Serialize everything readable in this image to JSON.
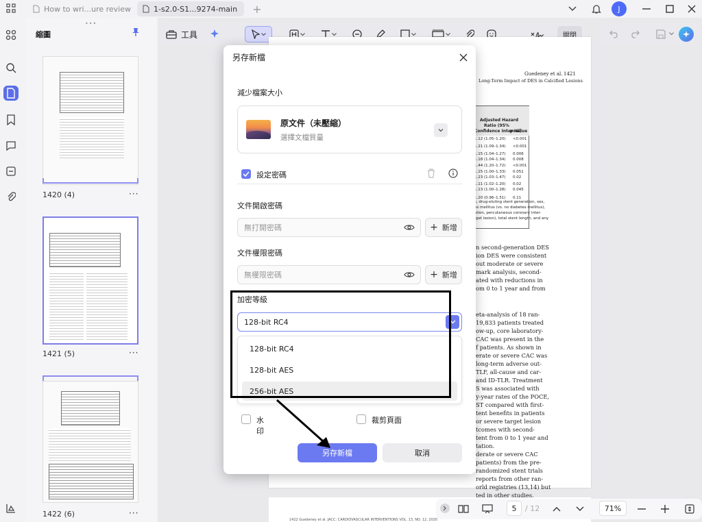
{
  "tabs": [
    {
      "title": "How to wri...ure review"
    },
    {
      "title": "1-s2.0-S1...9274-main"
    }
  ],
  "user": {
    "initial": "J"
  },
  "sidebar": {
    "title": "縮圖",
    "pages": [
      {
        "label": "1420 (4)"
      },
      {
        "label": "1421 (5)"
      },
      {
        "label": "1422 (6)"
      }
    ]
  },
  "toolbar": {
    "tools_label": "工具",
    "close_label": "關閉"
  },
  "document": {
    "header_author": "Guedeney et al.",
    "header_page": "1421",
    "header_title": "Long-Term Impact of DES in Calcified Lesions",
    "table_head_1": "Adjusted Hazard",
    "table_head_2": "Ratio (95%",
    "table_head_3": "Confidence Interval)",
    "table_head_pval": "p Value",
    "table_rows": [
      {
        "ci": "1.12 (1.05–1.20)",
        "p": "<0.001"
      },
      {
        "ci": "1.21 (1.09–1.34)",
        "p": "<0.001"
      },
      {
        "ci": "1.15 (1.04–1.27)",
        "p": "0.006"
      },
      {
        "ci": "1.18 (1.04–1.34)",
        "p": "0.008"
      },
      {
        "ci": "1.44 (1.20–1.72)",
        "p": "<0.001"
      },
      {
        "ci": "1.15 (1.00–1.33)",
        "p": "0.051"
      },
      {
        "ci": "1.23 (1.03–1.47)",
        "p": "0.02"
      },
      {
        "ci": "1.11 (1.02–1.20)",
        "p": "0.02"
      },
      {
        "ci": "1.13 (1.00–1.28)",
        "p": "0.045"
      },
      {
        "ci": "1.20 (0.96–1.51)",
        "p": "0.11"
      }
    ],
    "table_notes": [
      "s, drug-eluting stent generation, sex,",
      "es mellitus (vs. no diabetes mellitus),",
      "ation, percutaneous coronary inter-",
      "rget lesion), total stent length, and any"
    ],
    "body_lines_1": [
      "n second-generation DES",
      "ion DES were consistent",
      "out moderate or severe",
      "mark analysis, second-",
      "ated with reductions in",
      "om 0 to 1 year and from"
    ],
    "body_lines_2": [
      "eta-analysis of 18 ran-",
      "19,833 patients treated",
      "ow-up, core laboratory-",
      "CAC was present in the",
      "f patients. As shown in",
      "erate or severe CAC was",
      "long-term adverse out-",
      "TLF, all-cause and car-",
      "and ID-TLR. Treatment",
      "S was associated with",
      "y-year rates of the POCE,",
      "ST compared with first-",
      "tent benefits in patients",
      "or severe target lesion",
      "tcomes with second-",
      "tent from 0 to 1 year and",
      "tation.",
      "derate or severe CAC",
      "patients) from the pre-",
      "randomized stent trials",
      "reports from other ran-",
      "orld registries (13,14) but",
      "ted in other studies,"
    ],
    "next_page_footer": "1422    Guedeney et al.                                        JACC: CARDIOVASCULAR INTERVENTIONS VOL. 13, NO. 12, 2020"
  },
  "dialog": {
    "title": "另存新檔",
    "reduce_size_label": "減少檔案大小",
    "original_title": "原文件（未壓縮）",
    "original_subtitle": "選擇文檔質量",
    "set_password_label": "設定密碼",
    "set_password_checked": true,
    "open_password_label": "文件開啟密碼",
    "open_password_placeholder": "無打開密碼",
    "permission_password_label": "文件權限密碼",
    "permission_password_placeholder": "無權限密碼",
    "add_label": "新增",
    "encryption_label": "加密等級",
    "encryption_selected": "128-bit RC4",
    "encryption_options": [
      "128-bit RC4",
      "128-bit AES",
      "256-bit AES"
    ],
    "watermark_label": "水印",
    "crop_label": "裁剪頁面",
    "save_label": "另存新檔",
    "cancel_label": "取消"
  },
  "bottombar": {
    "current_page": "5",
    "total_pages": "/ 12",
    "zoom": "71%"
  },
  "colors": {
    "accent": "#6b7af0",
    "annotation": "#000000"
  }
}
